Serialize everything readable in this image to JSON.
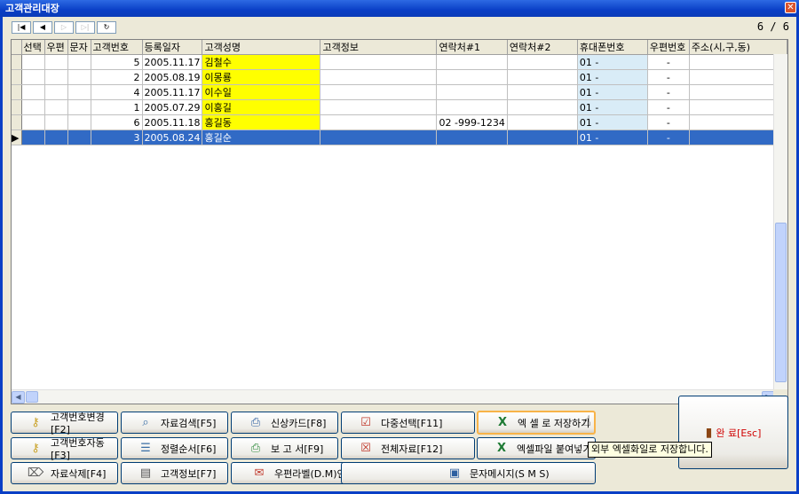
{
  "window": {
    "title": "고객관리대장",
    "close": "✕"
  },
  "nav": {
    "first": "|◀",
    "prev": "◀",
    "next": "▷",
    "last": "▷|",
    "refresh": "↻",
    "counter": "6 / 6"
  },
  "grid": {
    "columns": [
      "선택",
      "우편",
      "문자",
      "고객번호",
      "등록일자",
      "고객성명",
      "고객정보",
      "연락처#1",
      "연락처#2",
      "휴대폰번호",
      "우편번호",
      "주소(시,구,동)"
    ],
    "rows": [
      {
        "num": "5",
        "date": "2005.11.17",
        "name": "김철수",
        "info": "",
        "tel1": "",
        "tel2": "",
        "mobile": "01 -",
        "zip": "-"
      },
      {
        "num": "2",
        "date": "2005.08.19",
        "name": "이몽룡",
        "info": "",
        "tel1": "",
        "tel2": "",
        "mobile": "01 -",
        "zip": "-"
      },
      {
        "num": "4",
        "date": "2005.11.17",
        "name": "이수일",
        "info": "",
        "tel1": "",
        "tel2": "",
        "mobile": "01 -",
        "zip": "-"
      },
      {
        "num": "1",
        "date": "2005.07.29",
        "name": "이홍길",
        "info": "",
        "tel1": "",
        "tel2": "",
        "mobile": "01 -",
        "zip": "-"
      },
      {
        "num": "6",
        "date": "2005.11.18",
        "name": "홍길동",
        "info": "",
        "tel1": "02  -999-1234",
        "tel2": "",
        "mobile": "01 -",
        "zip": "-"
      },
      {
        "num": "3",
        "date": "2005.08.24",
        "name": "홍길순",
        "info": "",
        "tel1": "",
        "tel2": "",
        "mobile": "01 -",
        "zip": "-"
      }
    ],
    "current_marker": "▶"
  },
  "buttons": {
    "b1": "고객번호변경[F2]",
    "b2": "자료검색[F5]",
    "b3": "신상카드[F8]",
    "b4": "다중선택[F11]",
    "b5": "엑 셀 로 저장하기",
    "b6": "고객번호자동[F3]",
    "b7": "정렬순서[F6]",
    "b8": "보 고 서[F9]",
    "b9": "전체자료[F12]",
    "b10": "엑셀파일 붙여넣기",
    "b11": "자료삭제[F4]",
    "b12": "고객정보[F7]",
    "b13": "우편라벨(D.M)인쇄",
    "b14": "문자메시지(S M S)",
    "done": "완 료[Esc]"
  },
  "tooltip": "외부 엑셀화일로 저장합니다."
}
